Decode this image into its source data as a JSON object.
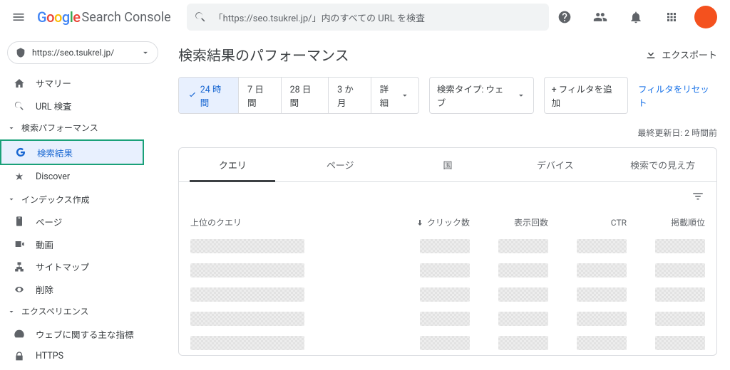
{
  "app_name_suffix": "Search Console",
  "search_placeholder": "「https://seo.tsukrel.jp/」内のすべての URL を検査",
  "property": "https://seo.tsukrel.jp/",
  "sidebar": {
    "summary": "サマリー",
    "url_inspect": "URL 検査",
    "perf_section": "検索パフォーマンス",
    "search_results": "検索結果",
    "discover": "Discover",
    "index_section": "インデックス作成",
    "pages": "ページ",
    "videos": "動画",
    "sitemaps": "サイトマップ",
    "removals": "削除",
    "experience_section": "エクスペリエンス",
    "cwv": "ウェブに関する主な指標",
    "https": "HTTPS"
  },
  "main": {
    "title": "検索結果のパフォーマンス",
    "export": "エクスポート",
    "date_ranges": [
      "24 時間",
      "7 日間",
      "28 日間",
      "3 か月",
      "詳細"
    ],
    "selected_range_index": 0,
    "search_type_label": "検索タイプ: ウェブ",
    "add_filter": "+ フィルタを追加",
    "reset_filters": "フィルタをリセット",
    "last_updated": "最終更新日: 2 時間前",
    "tabs": [
      "クエリ",
      "ページ",
      "国",
      "デバイス",
      "検索での見え方"
    ],
    "active_tab_index": 0,
    "columns": {
      "query": "上位のクエリ",
      "clicks": "クリック数",
      "impressions": "表示回数",
      "ctr": "CTR",
      "position": "掲載順位"
    },
    "row_count": 5
  }
}
